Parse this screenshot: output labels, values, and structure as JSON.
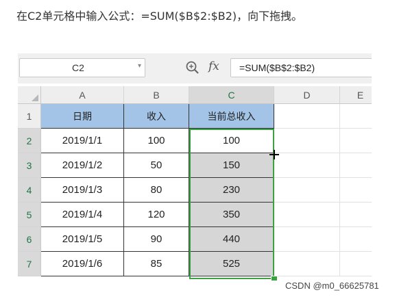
{
  "instruction": "在C2单元格中输入公式：=SUM($B$2:$B2)，向下拖拽。",
  "name_box": "C2",
  "formula_bar": {
    "fx": "fx",
    "formula": "=SUM($B$2:$B2)"
  },
  "columns": [
    "A",
    "B",
    "C",
    "D",
    "E"
  ],
  "rows": [
    "1",
    "2",
    "3",
    "4",
    "5",
    "6",
    "7"
  ],
  "table": {
    "headers": [
      "日期",
      "收入",
      "当前总收入"
    ],
    "rows": [
      [
        "2019/1/1",
        "100",
        "100"
      ],
      [
        "2019/1/2",
        "50",
        "150"
      ],
      [
        "2019/1/3",
        "80",
        "230"
      ],
      [
        "2019/1/4",
        "120",
        "350"
      ],
      [
        "2019/1/5",
        "90",
        "440"
      ],
      [
        "2019/1/6",
        "85",
        "525"
      ]
    ]
  },
  "colors": {
    "header_fill": "#a3c4e6",
    "selection_border": "#3aa33f",
    "selected_fill": "#d6d6d6"
  },
  "icons": [
    "zoom-icon",
    "fx-icon",
    "dropdown-arrow-icon",
    "fill-cursor-icon"
  ],
  "watermark": "CSDN @m0_66625781"
}
